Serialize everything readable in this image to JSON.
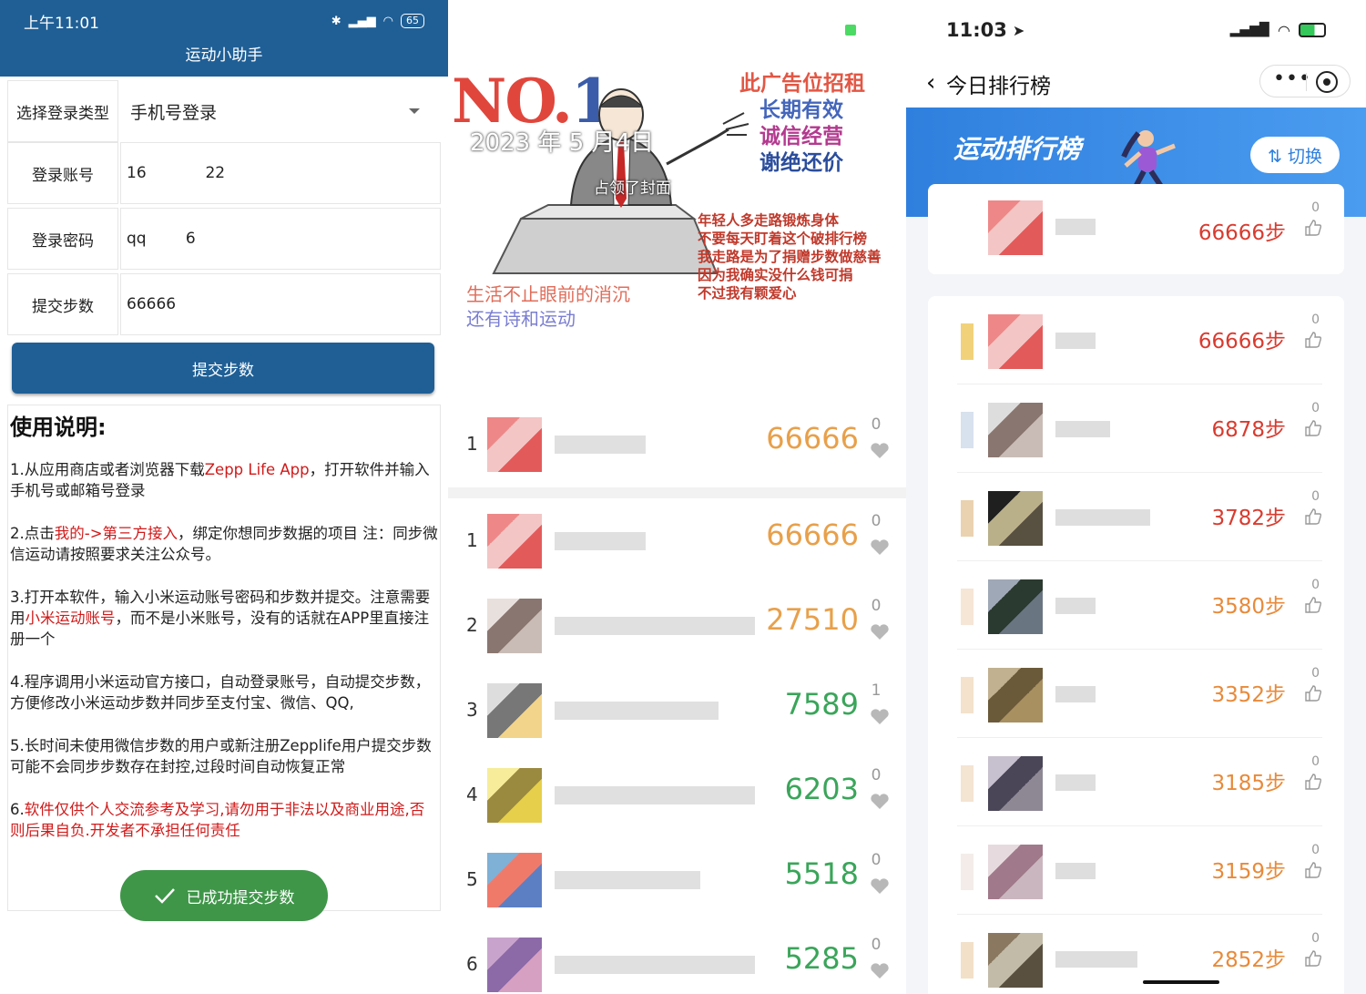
{
  "panel1": {
    "status": {
      "time": "上午11:01",
      "battery": "65"
    },
    "title": "运动小助手",
    "form": {
      "login_type_label": "选择登录类型",
      "login_type_value": "手机号登录",
      "account_label": "登录账号",
      "account_value": "16            22",
      "password_label": "登录密码",
      "password_value": "qq        6",
      "steps_label": "提交步数",
      "steps_value": "66666"
    },
    "submit_label": "提交步数",
    "instructions": {
      "heading": "使用说明:",
      "s1_a": "1.从应用商店或者浏览器下载",
      "s1_red": "Zepp Life App",
      "s1_b": "，打开软件并输入手机号或邮箱号登录",
      "s2_a": "2.点击",
      "s2_red": "我的->第三方接入",
      "s2_b": "，绑定你想同步数据的项目 注：同步微信运动请按照要求关注公众号。",
      "s3_a": "3.打开本软件，输入小米运动账号密码和步数并提交。注意需要用",
      "s3_red": "小米运动账号",
      "s3_b": "，而不是小米账号，没有的话就在APP里直接注册一个",
      "s4": "4.程序调用小米运动官方接口，自动登录账号，自动提交步数，方便修改小米运动步数并同步至支付宝、微信、QQ,",
      "s5": "5.长时间未使用微信步数的用户或新注册Zepplife用户提交步数可能不会同步步数存在封控,过段时间自动恢复正常",
      "s6_num": "6.",
      "s6_red": "软件仅供个人交流参考及学习,请勿用于非法以及商业用途,否则后果自负.开发者不承担任何责任"
    },
    "toast": "已成功提交步数"
  },
  "panel2": {
    "banner": {
      "no1_a": "NO.",
      "no1_b": "1",
      "date": "2023 年 5 月4日",
      "cover": "占领了封面",
      "ad": [
        "此广告位招租",
        "长期有效",
        "诚信经营",
        "谢绝还价"
      ],
      "ad_lines": [
        "年轻人多走路锻炼身体",
        "不要每天盯着这个破排行榜",
        "我走路是为了捐赠步数做慈善",
        "因为我确实没什么钱可捐",
        "不过我有颗爱心"
      ],
      "slogan": [
        "生活不止眼前的消沉",
        "还有诗和运动"
      ]
    },
    "my_row": {
      "rank": "1",
      "steps": "66666",
      "likes": "0"
    },
    "rows": [
      {
        "rank": "1",
        "steps": "66666",
        "likes": "0"
      },
      {
        "rank": "2",
        "steps": "27510",
        "likes": "0"
      },
      {
        "rank": "3",
        "steps": "7589",
        "likes": "1"
      },
      {
        "rank": "4",
        "steps": "6203",
        "likes": "0"
      },
      {
        "rank": "5",
        "steps": "5518",
        "likes": "0"
      },
      {
        "rank": "6",
        "steps": "5285",
        "likes": "0"
      }
    ],
    "colors": {
      "orange": "#e8a04a",
      "green": "#3aa55a"
    }
  },
  "panel3": {
    "status": {
      "time": "11:03"
    },
    "nav_title": "今日排行榜",
    "hero_title": "运动排行榜",
    "switch_label": "⇅ 切换",
    "my_row": {
      "steps": "66666步",
      "likes": "0"
    },
    "rows": [
      {
        "steps": "66666步",
        "likes": "0"
      },
      {
        "steps": "6878步",
        "likes": "0"
      },
      {
        "steps": "3782步",
        "likes": "0"
      },
      {
        "steps": "3580步",
        "likes": "0"
      },
      {
        "steps": "3352步",
        "likes": "0"
      },
      {
        "steps": "3185步",
        "likes": "0"
      },
      {
        "steps": "3159步",
        "likes": "0"
      },
      {
        "steps": "2852步",
        "likes": "0"
      }
    ],
    "colors": {
      "red": "#d93b2f",
      "orange": "#e88a3a"
    }
  }
}
